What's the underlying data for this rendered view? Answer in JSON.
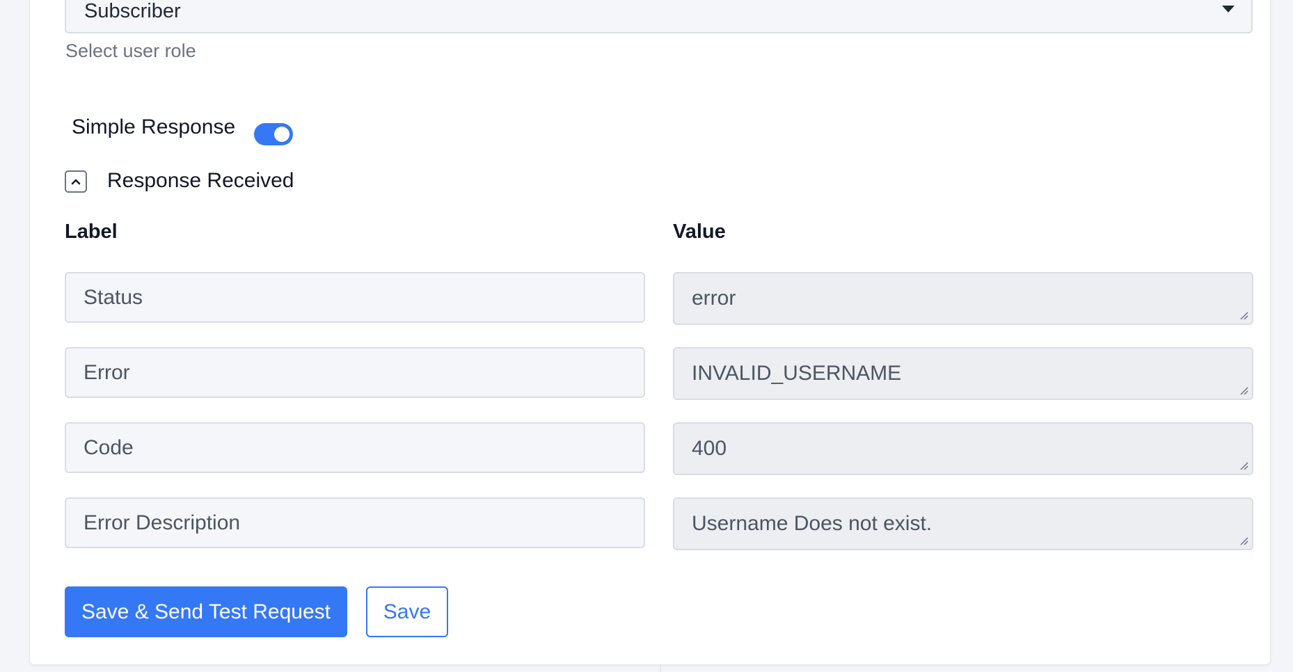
{
  "role_select": {
    "value": "Subscriber",
    "helper": "Select user role"
  },
  "simple_response": {
    "label": "Simple Response",
    "enabled": true
  },
  "response_section": {
    "title": "Response Received",
    "expanded": true
  },
  "columns": {
    "label": "Label",
    "value": "Value"
  },
  "rows": [
    {
      "label": "Status",
      "value": "error"
    },
    {
      "label": "Error",
      "value": "INVALID_USERNAME"
    },
    {
      "label": "Code",
      "value": "400"
    },
    {
      "label": "Error Description",
      "value": "Username Does not exist."
    }
  ],
  "actions": {
    "save_send": "Save & Send Test Request",
    "save": "Save"
  },
  "colors": {
    "primary": "#3478f6",
    "page_bg": "#f3f5f8",
    "field_border": "#d9dde4"
  }
}
